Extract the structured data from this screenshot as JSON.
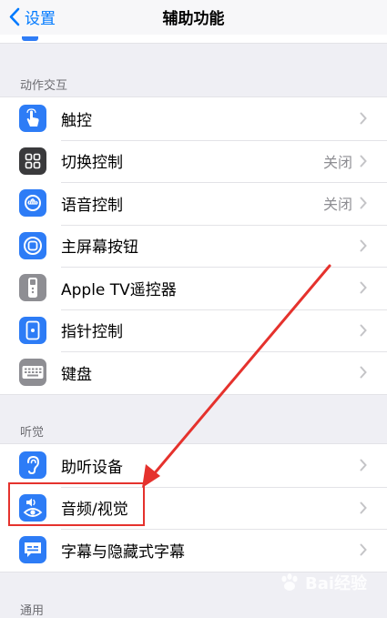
{
  "nav": {
    "back_label": "设置",
    "title": "辅助功能"
  },
  "sections": [
    {
      "header": "动作交互",
      "rows": [
        {
          "label": "触控",
          "value": "",
          "icon": "touch-hand-icon",
          "color": "#2d7cf6"
        },
        {
          "label": "切换控制",
          "value": "关闭",
          "icon": "switch-control-grid-icon",
          "color": "#3a3a3c"
        },
        {
          "label": "语音控制",
          "value": "关闭",
          "icon": "voice-control-icon",
          "color": "#2d7cf6"
        },
        {
          "label": "主屏幕按钮",
          "value": "",
          "icon": "home-button-icon",
          "color": "#2d7cf6"
        },
        {
          "label": "Apple TV遥控器",
          "value": "",
          "icon": "apple-tv-remote-icon",
          "color": "#8e8e93"
        },
        {
          "label": "指针控制",
          "value": "",
          "icon": "pointer-control-icon",
          "color": "#2d7cf6"
        },
        {
          "label": "键盘",
          "value": "",
          "icon": "keyboard-icon",
          "color": "#8e8e93"
        }
      ]
    },
    {
      "header": "听觉",
      "rows": [
        {
          "label": "助听设备",
          "value": "",
          "icon": "ear-icon",
          "color": "#2d7cf6"
        },
        {
          "label": "音频/视觉",
          "value": "",
          "icon": "audio-visual-icon",
          "color": "#2d7cf6"
        },
        {
          "label": "字幕与隐藏式字幕",
          "value": "",
          "icon": "subtitles-icon",
          "color": "#2d7cf6"
        }
      ]
    },
    {
      "header": "通用",
      "rows": []
    }
  ],
  "watermark": {
    "text": "Bai经验"
  },
  "colors": {
    "accent": "#007aff",
    "annotation": "#e5322d"
  }
}
